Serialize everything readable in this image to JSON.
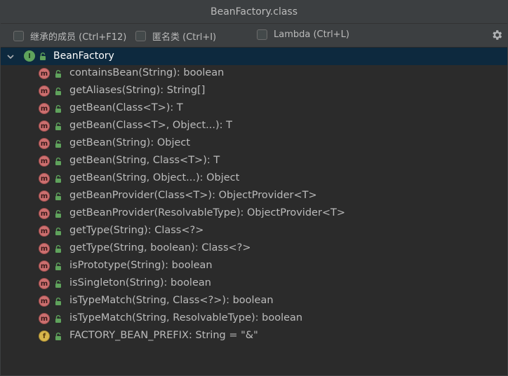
{
  "window": {
    "title": "BeanFactory.class"
  },
  "toolbar": {
    "options": [
      {
        "label": "继承的成员 (Ctrl+F12)",
        "checked": false
      },
      {
        "label": "匿名类 (Ctrl+I)",
        "checked": false
      },
      {
        "label": "Lambda (Ctrl+L)",
        "checked": false
      }
    ],
    "settings_icon": "gear-icon"
  },
  "tree": {
    "root": {
      "label": "BeanFactory",
      "icon": "interface-icon",
      "badge": "I"
    },
    "members": [
      {
        "label": "containsBean(String): boolean",
        "kind": "method",
        "badge": "m"
      },
      {
        "label": "getAliases(String): String[]",
        "kind": "method",
        "badge": "m"
      },
      {
        "label": "getBean(Class<T>): T",
        "kind": "method",
        "badge": "m"
      },
      {
        "label": "getBean(Class<T>, Object...): T",
        "kind": "method",
        "badge": "m"
      },
      {
        "label": "getBean(String): Object",
        "kind": "method",
        "badge": "m"
      },
      {
        "label": "getBean(String, Class<T>): T",
        "kind": "method",
        "badge": "m"
      },
      {
        "label": "getBean(String, Object...): Object",
        "kind": "method",
        "badge": "m"
      },
      {
        "label": "getBeanProvider(Class<T>): ObjectProvider<T>",
        "kind": "method",
        "badge": "m"
      },
      {
        "label": "getBeanProvider(ResolvableType): ObjectProvider<T>",
        "kind": "method",
        "badge": "m"
      },
      {
        "label": "getType(String): Class<?>",
        "kind": "method",
        "badge": "m"
      },
      {
        "label": "getType(String, boolean): Class<?>",
        "kind": "method",
        "badge": "m"
      },
      {
        "label": "isPrototype(String): boolean",
        "kind": "method",
        "badge": "m"
      },
      {
        "label": "isSingleton(String): boolean",
        "kind": "method",
        "badge": "m"
      },
      {
        "label": "isTypeMatch(String, Class<?>): boolean",
        "kind": "method",
        "badge": "m"
      },
      {
        "label": "isTypeMatch(String, ResolvableType): boolean",
        "kind": "method",
        "badge": "m"
      },
      {
        "label": "FACTORY_BEAN_PREFIX: String = \"&\"",
        "kind": "field",
        "badge": "f"
      }
    ]
  },
  "colors": {
    "background": "#2b2b2b",
    "toolbar": "#3c3f41",
    "selection": "#0d293e",
    "method_badge": "#cc6f6f",
    "field_badge": "#d8b64b",
    "interface_badge": "#5fa35c",
    "lock": "#5fa35c"
  }
}
